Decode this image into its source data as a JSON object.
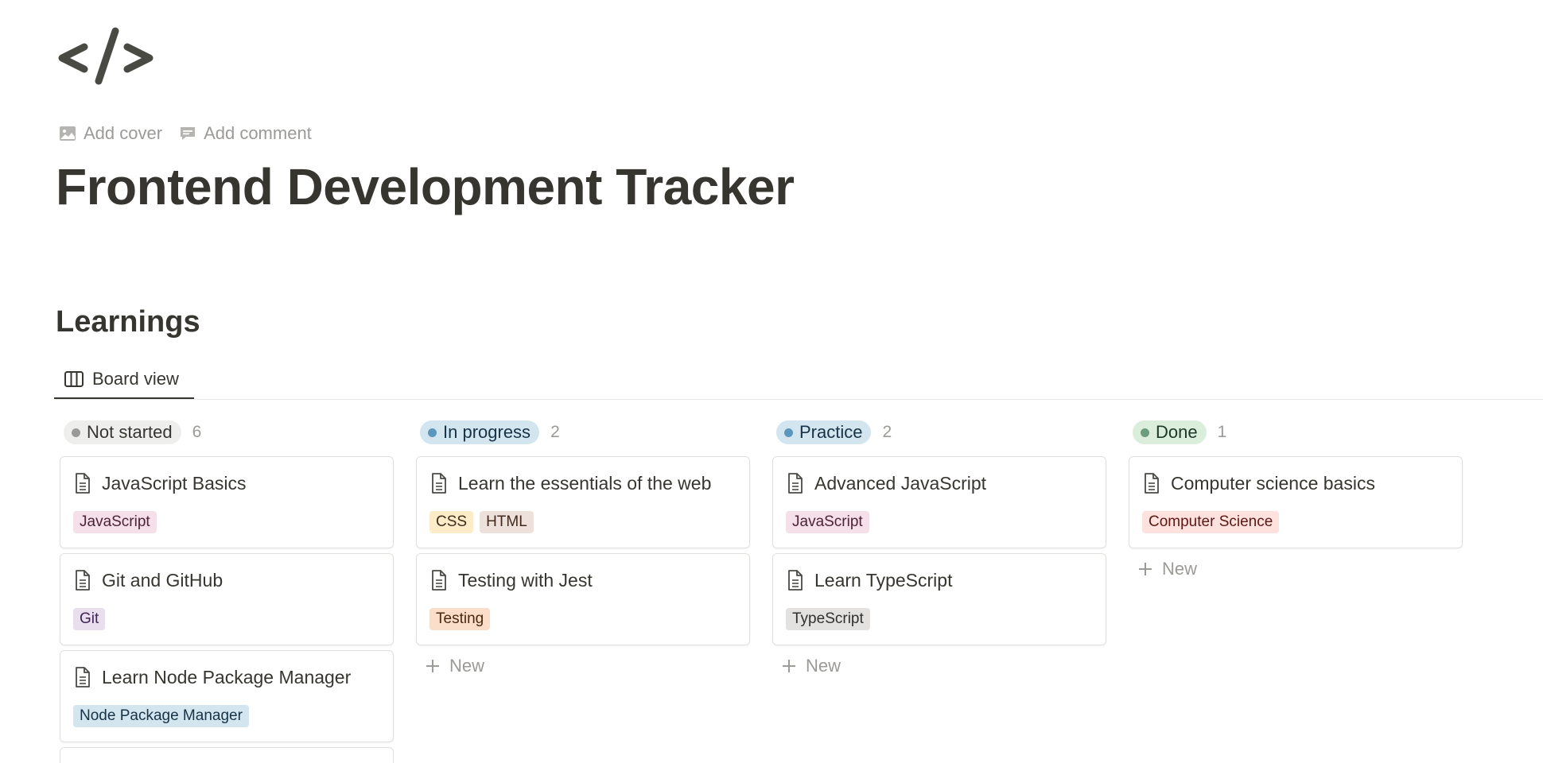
{
  "page": {
    "icon": "code-icon",
    "actions": {
      "add_cover": "Add cover",
      "add_comment": "Add comment"
    },
    "title": "Frontend Development Tracker"
  },
  "database": {
    "title": "Learnings",
    "tabs": [
      {
        "label": "Board view",
        "icon": "board-icon"
      }
    ],
    "new_label": "New",
    "columns": [
      {
        "status": "Not started",
        "count": "6",
        "pill_bg": "#eeeeed",
        "dot": "#9b9a97",
        "text": "#37352f",
        "cards": [
          {
            "title": "JavaScript Basics",
            "tags": [
              "JavaScript"
            ]
          },
          {
            "title": "Git and GitHub",
            "tags": [
              "Git"
            ]
          },
          {
            "title": "Learn Node Package Manager",
            "tags": [
              "Node Package Manager"
            ]
          }
        ]
      },
      {
        "status": "In progress",
        "count": "2",
        "pill_bg": "#d3e5ef",
        "dot": "#5b97bd",
        "text": "#183347",
        "cards": [
          {
            "title": "Learn the essentials of the web",
            "tags": [
              "CSS",
              "HTML"
            ]
          },
          {
            "title": "Testing with Jest",
            "tags": [
              "Testing"
            ]
          }
        ]
      },
      {
        "status": "Practice",
        "count": "2",
        "pill_bg": "#d3e5ef",
        "dot": "#5b97bd",
        "text": "#183347",
        "cards": [
          {
            "title": "Advanced JavaScript",
            "tags": [
              "JavaScript"
            ]
          },
          {
            "title": "Learn TypeScript",
            "tags": [
              "TypeScript"
            ]
          }
        ]
      },
      {
        "status": "Done",
        "count": "1",
        "pill_bg": "#dbeddb",
        "dot": "#6c9b7d",
        "text": "#1c3829",
        "cards": [
          {
            "title": "Computer science basics",
            "tags": [
              "Computer Science"
            ]
          }
        ]
      }
    ],
    "tag_colors": {
      "JavaScript": {
        "bg": "#f5e0e9",
        "fg": "#4c2337"
      },
      "Git": {
        "bg": "#e8deee",
        "fg": "#412454"
      },
      "Node Package Manager": {
        "bg": "#d3e5ef",
        "fg": "#183347"
      },
      "CSS": {
        "bg": "#fdecc8",
        "fg": "#402c1b"
      },
      "HTML": {
        "bg": "#eee0da",
        "fg": "#442a1e"
      },
      "Testing": {
        "bg": "#fadec9",
        "fg": "#49290e"
      },
      "TypeScript": {
        "bg": "#e3e2e0",
        "fg": "#32302c"
      },
      "Computer Science": {
        "bg": "#ffe2dd",
        "fg": "#5d1715"
      }
    }
  }
}
